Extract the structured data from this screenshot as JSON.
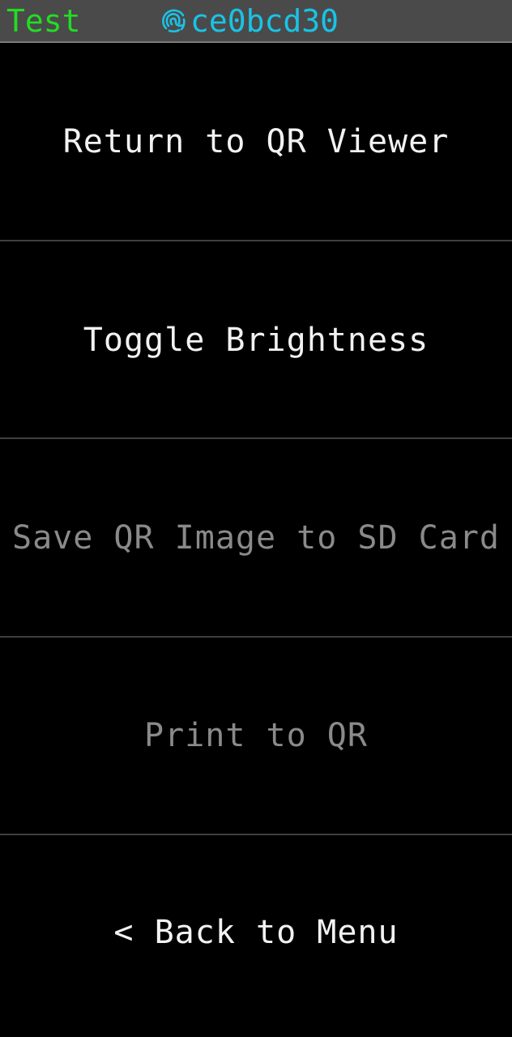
{
  "header": {
    "title": "Test",
    "fingerprint_icon": "fingerprint-icon",
    "fingerprint_id": "ce0bcd30",
    "title_color": "#22dd22",
    "id_color": "#19c3e6"
  },
  "menu": {
    "items": [
      {
        "label": "Return to QR Viewer",
        "enabled": true
      },
      {
        "label": "Toggle Brightness",
        "enabled": true
      },
      {
        "label": "Save QR Image to SD Card",
        "enabled": false
      },
      {
        "label": "Print to QR",
        "enabled": false
      },
      {
        "label": "< Back to Menu",
        "enabled": true
      }
    ]
  }
}
